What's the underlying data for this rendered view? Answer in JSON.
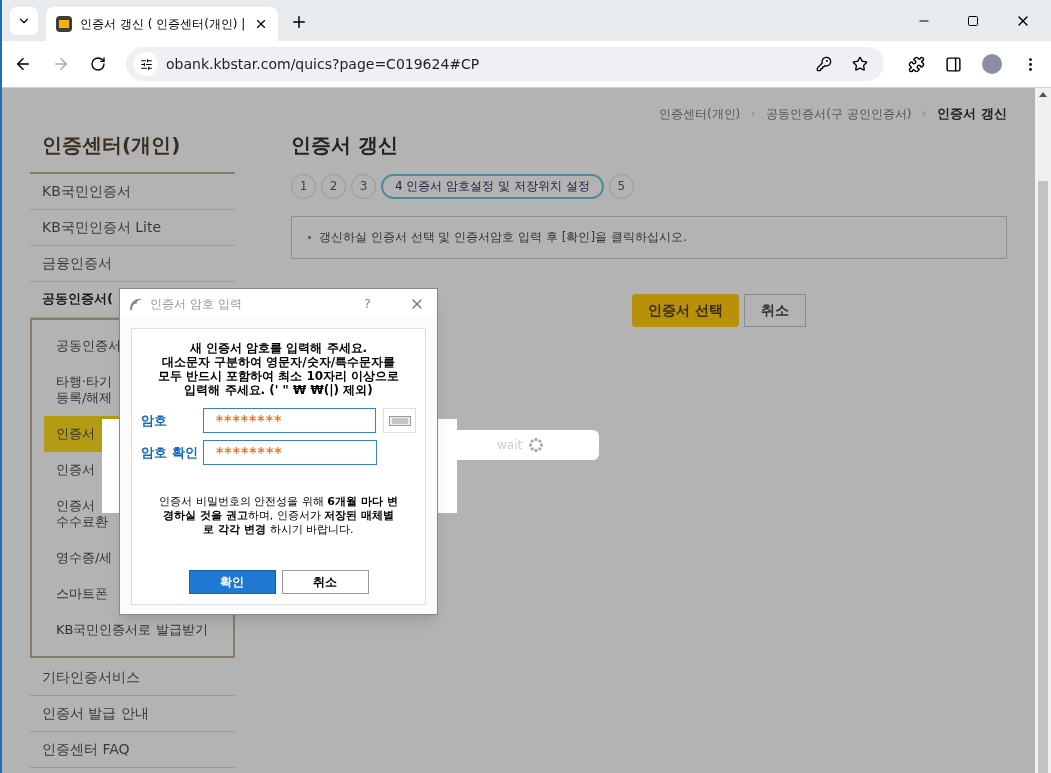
{
  "browser": {
    "tab_title": "인증서 갱신 ( 인증센터(개인) |",
    "url": "obank.kbstar.com/quics?page=C019624#CP"
  },
  "breadcrumb": [
    {
      "label": "인증센터(개인)",
      "selected": false
    },
    {
      "label": "공동인증서(구 공인인증서)",
      "selected": false
    },
    {
      "label": "인증서 갱신",
      "selected": true
    }
  ],
  "sidebar": {
    "title": "인증센터(개인)",
    "items": [
      {
        "label": "KB국민인증서",
        "selected": false
      },
      {
        "label": "KB국민인증서 Lite",
        "selected": false
      },
      {
        "label": "금융인증서",
        "selected": false
      },
      {
        "label": "공동인증서(",
        "selected": false,
        "children": [
          {
            "label": "공동인증서",
            "selected": false
          },
          {
            "label": "타행·타기\n등록/해제",
            "selected": false
          },
          {
            "label": "인증서",
            "selected": true
          },
          {
            "label": "인증서",
            "selected": false
          },
          {
            "label": "인증서\n수수료환",
            "selected": false
          },
          {
            "label": "영수증/세",
            "selected": false
          },
          {
            "label": "스마트폰",
            "selected": false
          },
          {
            "label": "KB국민인증서로 발급받기",
            "selected": false
          }
        ]
      },
      {
        "label": "기타인증서비스",
        "selected": false
      },
      {
        "label": "인증서 발급 안내",
        "selected": false
      },
      {
        "label": "인증센터 FAQ",
        "selected": false
      }
    ]
  },
  "page": {
    "title": "인증서 갱신",
    "steps": [
      {
        "label": "1",
        "selected": false
      },
      {
        "label": "2",
        "selected": false
      },
      {
        "label": "3",
        "selected": false
      },
      {
        "label": "4 인증서 암호설정 및 저장위치 설정",
        "selected": true
      },
      {
        "label": "5",
        "selected": false
      }
    ],
    "notice": "갱신하실 인증서 선택 및 인증서암호 입력 후 [확인]을 클릭하십시오.",
    "buttons": [
      {
        "label": "인증서 선택",
        "kind": "primary"
      },
      {
        "label": "취소",
        "kind": "secondary"
      }
    ]
  },
  "loading": {
    "text": "wait"
  },
  "dialog": {
    "title": "인증서 암호 입력",
    "help": "?",
    "instructions": [
      "새 인증서 암호를 입력해 주세요.",
      "대소문자 구분하여 영문자/숫자/특수문자를",
      "모두 반드시 포함하여 최소 10자리 이상으로",
      "입력해 주세요. (' \" ₩ ₩(|) 제외)"
    ],
    "fields": [
      {
        "label": "암호",
        "value": "********",
        "keyboard": true
      },
      {
        "label": "암호 확인",
        "value": "********",
        "keyboard": false
      }
    ],
    "note": "인증서 비밀번호의 안전성을 위해 **6개월 마다 변경하실 것을 권고**하며, 인증서가 **저장된 매체별로 각각 변경** 하시기 바랍니다.",
    "buttons": [
      {
        "label": "확인",
        "kind": "primary"
      },
      {
        "label": "취소",
        "kind": "secondary"
      }
    ]
  }
}
